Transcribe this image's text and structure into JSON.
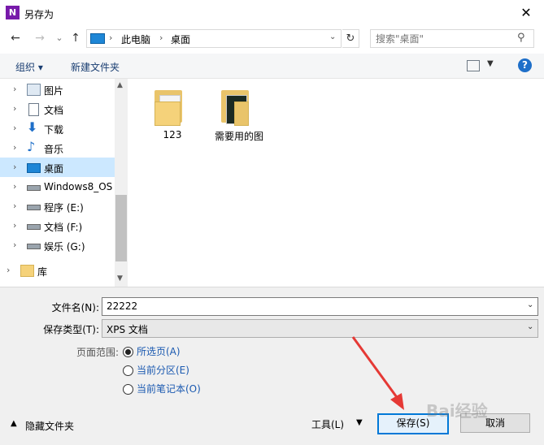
{
  "window": {
    "title": "另存为",
    "app_icon_letter": "N"
  },
  "nav": {
    "back": "←",
    "forward": "→",
    "recent": "⌄",
    "up": "↑"
  },
  "address": {
    "crumbs": [
      "此电脑",
      "桌面"
    ],
    "separator": "›"
  },
  "search": {
    "placeholder": "搜索\"桌面\""
  },
  "toolbar": {
    "organize_label": "组织 ▾",
    "new_folder_label": "新建文件夹",
    "help": "?"
  },
  "sidebar": {
    "items": [
      {
        "label": "图片",
        "icon": "pictures-icon"
      },
      {
        "label": "文档",
        "icon": "documents-icon"
      },
      {
        "label": "下载",
        "icon": "download-icon"
      },
      {
        "label": "音乐",
        "icon": "music-icon"
      },
      {
        "label": "桌面",
        "icon": "desktop-icon",
        "selected": true
      },
      {
        "label": "Windows8_OS",
        "icon": "system-drive-icon"
      },
      {
        "label": "程序 (E:)",
        "icon": "drive-icon"
      },
      {
        "label": "文档 (F:)",
        "icon": "drive-icon"
      },
      {
        "label": "娱乐 (G:)",
        "icon": "drive-icon"
      },
      {
        "label": "库",
        "icon": "library-icon"
      }
    ]
  },
  "files": [
    {
      "name": "123",
      "type": "folder"
    },
    {
      "name": "需要用的图",
      "type": "folder"
    }
  ],
  "form": {
    "filename_label": "文件名(N):",
    "filename_value": "22222",
    "filetype_label": "保存类型(T):",
    "filetype_value": "XPS 文档",
    "range_label": "页面范围:",
    "range_options": [
      "所选页(A)",
      "当前分区(E)",
      "当前笔记本(O)"
    ],
    "range_selected": 0
  },
  "footer": {
    "hide_folders": "隐藏文件夹",
    "tools": "工具(L)",
    "save": "保存(S)",
    "cancel": "取消"
  },
  "watermark": "Bai经验",
  "colors": {
    "accent": "#0078d7",
    "selection": "#cce8ff",
    "onenote": "#7719aa",
    "arrow": "#e53935"
  }
}
